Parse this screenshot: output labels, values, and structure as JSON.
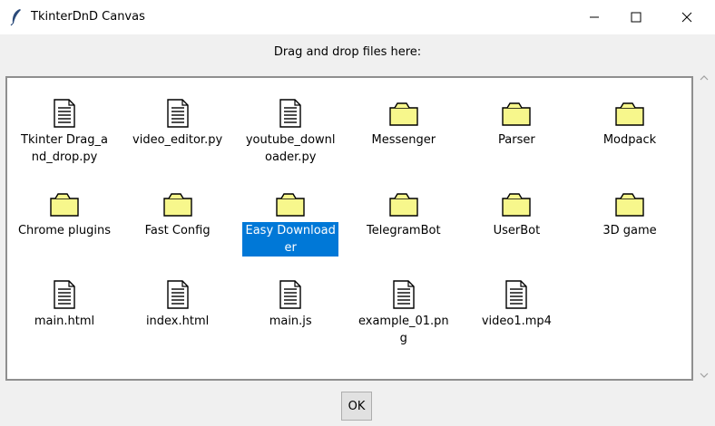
{
  "window": {
    "title": "TkinterDnD Canvas",
    "controls": {
      "minimize": "minimize-icon",
      "maximize": "maximize-icon",
      "close": "close-icon"
    }
  },
  "prompt": "Drag and drop files here:",
  "colors": {
    "selection": "#0078d7",
    "folder_fill": "#f7f78c",
    "canvas_bg": "#ffffff",
    "window_bg": "#f0f0f0"
  },
  "items": [
    {
      "label": "Tkinter Drag_and_drop.py",
      "kind": "file",
      "icon": "text-file-icon"
    },
    {
      "label": "video_editor.py",
      "kind": "file",
      "icon": "text-file-icon"
    },
    {
      "label": "youtube_downloader.py",
      "kind": "file",
      "icon": "text-file-icon"
    },
    {
      "label": "Messenger",
      "kind": "folder",
      "icon": "folder-icon"
    },
    {
      "label": "Parser",
      "kind": "folder",
      "icon": "folder-icon"
    },
    {
      "label": "Modpack",
      "kind": "folder",
      "icon": "folder-icon"
    },
    {
      "label": "Chrome plugins",
      "kind": "folder",
      "icon": "folder-icon"
    },
    {
      "label": "Fast Config",
      "kind": "folder",
      "icon": "folder-icon"
    },
    {
      "label": "Easy Downloader",
      "kind": "folder",
      "icon": "folder-icon",
      "selected": true
    },
    {
      "label": "TelegramBot",
      "kind": "folder",
      "icon": "folder-icon"
    },
    {
      "label": "UserBot",
      "kind": "folder",
      "icon": "folder-icon"
    },
    {
      "label": "3D game",
      "kind": "folder",
      "icon": "folder-icon"
    },
    {
      "label": "main.html",
      "kind": "file",
      "icon": "text-file-icon"
    },
    {
      "label": "index.html",
      "kind": "file",
      "icon": "text-file-icon"
    },
    {
      "label": "main.js",
      "kind": "file",
      "icon": "text-file-icon"
    },
    {
      "label": "example_01.png",
      "kind": "file",
      "icon": "text-file-icon"
    },
    {
      "label": "video1.mp4",
      "kind": "file",
      "icon": "text-file-icon"
    }
  ],
  "ok_button": "OK"
}
